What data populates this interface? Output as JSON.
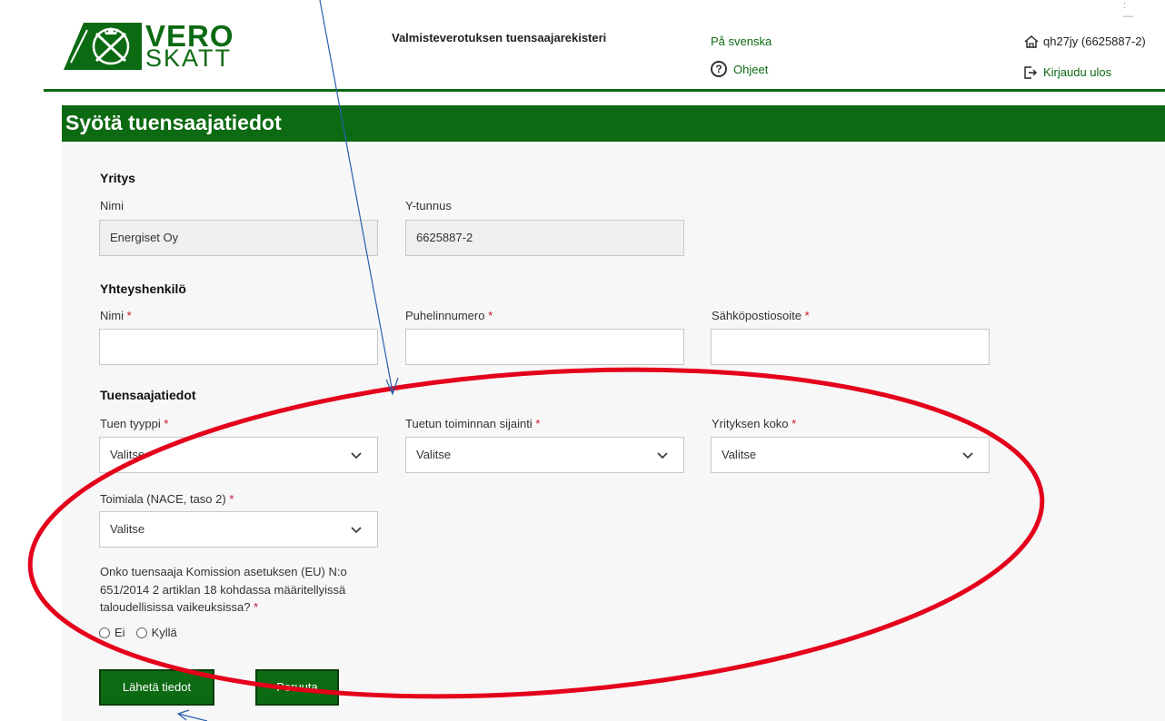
{
  "header": {
    "logo_top": "VERO",
    "logo_bottom": "SKATT",
    "app_title": "Valmisteverotuksen tuensaajarekisteri",
    "lang_link": "På svenska",
    "help_link": "Ohjeet",
    "user_id": "qh27jy (6625887-2)",
    "logout_link": "Kirjaudu ulos",
    "window_controls": ": —"
  },
  "page": {
    "title": "Syötä tuensaajatiedot"
  },
  "company": {
    "section_title": "Yritys",
    "name_label": "Nimi",
    "name_value": "Energiset Oy",
    "id_label": "Y-tunnus",
    "id_value": "6625887-2"
  },
  "contact": {
    "section_title": "Yhteyshenkilö",
    "name_label": "Nimi",
    "phone_label": "Puhelinnumero",
    "email_label": "Sähköpostiosoite",
    "required_mark": "*"
  },
  "beneficiary": {
    "section_title": "Tuensaajatiedot",
    "aid_type_label": "Tuen tyyppi",
    "location_label": "Tuetun toiminnan sijainti",
    "size_label": "Yrityksen koko",
    "industry_label": "Toimiala (NACE, taso 2)",
    "select_placeholder": "Valitse",
    "question": "Onko tuensaaja Komission asetuksen (EU) N:o 651/2014 2 artiklan 18 kohdassa määritellyissä taloudellisissa vaikeuksissa?",
    "radio_no": "Ei",
    "radio_yes": "Kyllä"
  },
  "actions": {
    "submit_label": "Lähetä tiedot",
    "cancel_label": "Peruuta"
  },
  "colors": {
    "brand_green": "#0c6a12",
    "annotation_red": "#e4001b",
    "annotation_arrow": "#2a5fae",
    "required": "#c8102e"
  }
}
